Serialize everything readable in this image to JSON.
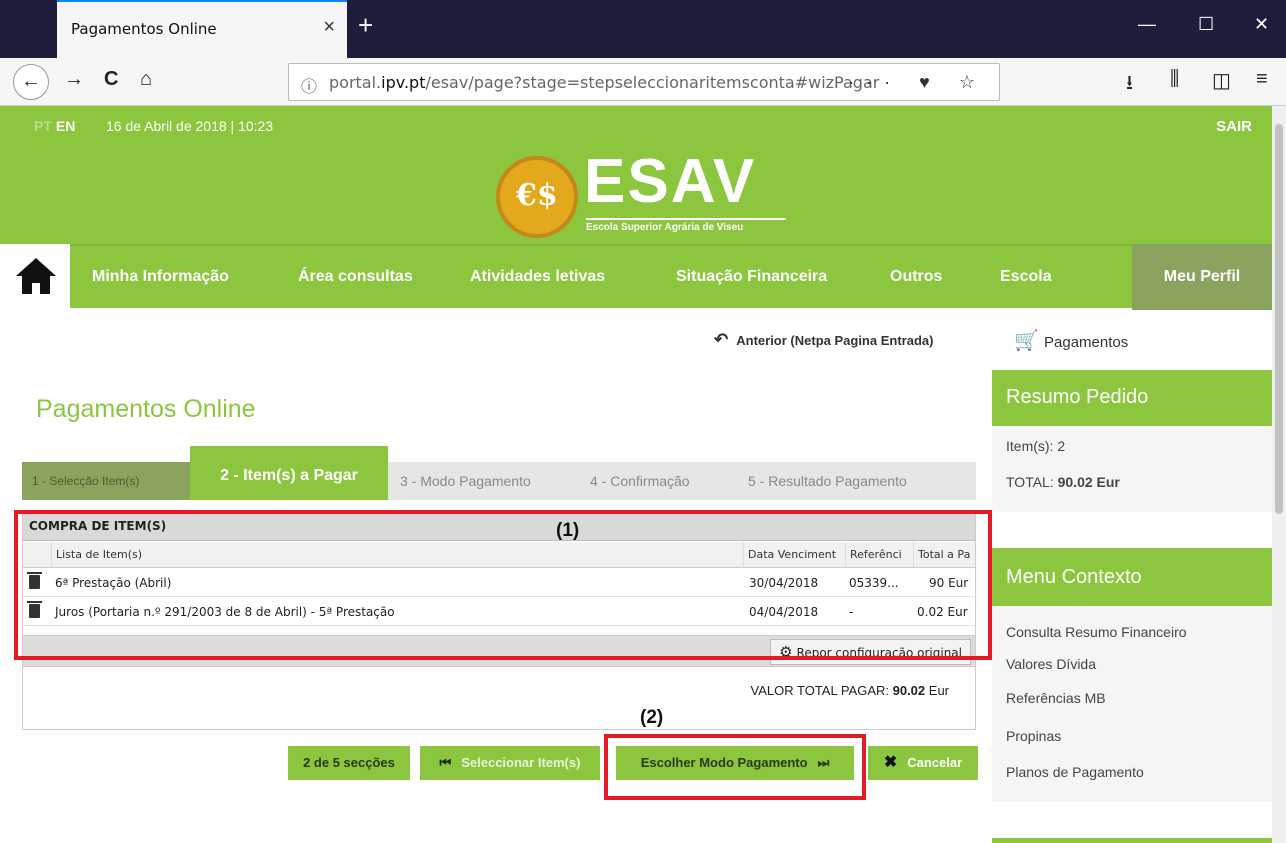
{
  "browser": {
    "tab_title": "Pagamentos Online",
    "tab_close": "×",
    "new_tab": "+",
    "url_host_prefix": "portal.",
    "url_host": "ipv.pt",
    "url_path": "/esav/page?stage=stepseleccionaritemsconta#wizPagar",
    "win_min": "—",
    "win_max": "☐",
    "win_close": "✕",
    "back": "←",
    "forward": "→",
    "reload": "C",
    "home": "⌂",
    "info": "ⓘ",
    "url_actions": "··· ♥ ☆",
    "download": "⭳",
    "library": "⫼",
    "sidebar": "◫",
    "menu": "≡"
  },
  "header": {
    "lang_pt": "PT",
    "lang_en": "EN",
    "datetime": "16 de Abril de 2018 | 10:23",
    "logout": "SAIR",
    "logo_mark": "ESAV",
    "logo_sub": "Escola Superior Agrária de Viseu"
  },
  "nav": {
    "items": [
      "Minha Informação",
      "Área consultas",
      "Atividades letivas",
      "Situação Financeira",
      "Outros",
      "Escola"
    ],
    "profile": "Meu Perfil"
  },
  "content": {
    "back_link": "Anterior (Netpa Pagina Entrada)",
    "title": "Pagamentos Online",
    "steps": [
      "1 - Selecção Item(s)",
      "2 - Item(s) a Pagar",
      "3 - Modo Pagamento",
      "4 - Confirmação",
      "5 - Resultado Pagamento"
    ],
    "grid": {
      "title": "COMPRA DE ITEM(S)",
      "columns": [
        "Lista de Item(s)",
        "Data Venciment",
        "Referênci",
        "Total a Pa"
      ],
      "rows": [
        {
          "item": "6ª Prestação (Abril)",
          "due": "30/04/2018",
          "ref": "05339...",
          "total": "90 Eur"
        },
        {
          "item": "Juros (Portaria n.º 291/2003 de 8 de Abril) - 5ª Prestação",
          "due": "04/04/2018",
          "ref": "-",
          "total": "0.02 Eur"
        }
      ],
      "reset_label": "Repor configuração original",
      "total_label": "VALOR TOTAL PAGAR: ",
      "total_value": "90.02",
      "total_unit": " Eur"
    },
    "annotations": {
      "one": "(1)",
      "two": "(2)"
    },
    "buttons": {
      "sections": "2 de 5 secções",
      "select_items": "Seleccionar Item(s)",
      "choose_mode": "Escolher Modo Pagamento",
      "cancel": "Cancelar"
    }
  },
  "sidebar": {
    "payments_label": "Pagamentos",
    "summary_title": "Resumo Pedido",
    "items_label": "Item(s): ",
    "items_count": "2",
    "total_label": "TOTAL: ",
    "total_value": "90.02 Eur",
    "menu_title": "Menu Contexto",
    "menu_links": [
      "Consulta Resumo Financeiro",
      "Valores Dívida",
      "Referências MB",
      "Propinas",
      "Planos de Pagamento"
    ]
  },
  "colors": {
    "brand_green": "#8cc63e",
    "muted_green": "#8aa460",
    "annotation_red": "#e01b24"
  }
}
